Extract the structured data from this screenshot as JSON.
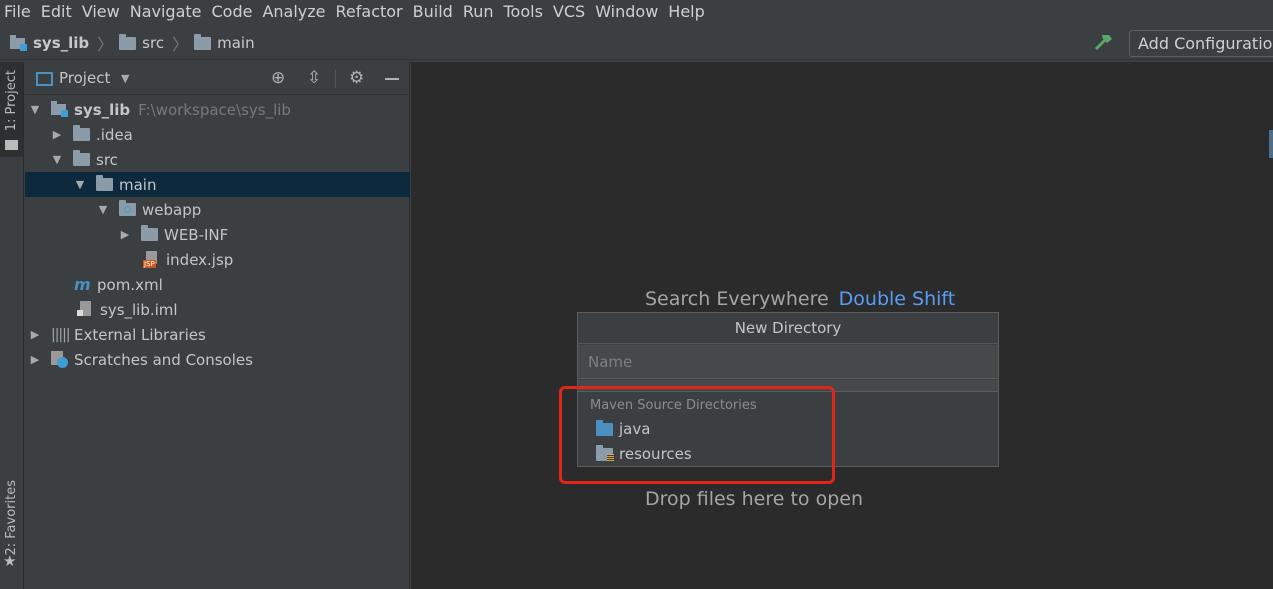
{
  "menu": [
    "File",
    "Edit",
    "View",
    "Navigate",
    "Code",
    "Analyze",
    "Refactor",
    "Build",
    "Run",
    "Tools",
    "VCS",
    "Window",
    "Help"
  ],
  "breadcrumb": {
    "project": "sys_lib",
    "src": "src",
    "main": "main"
  },
  "toolbar": {
    "add_configuration": "Add Configuration..."
  },
  "left_strip": {
    "project_tab": "1: Project",
    "favorites_tab": "2: Favorites"
  },
  "project_panel": {
    "title": "Project",
    "tree": [
      {
        "label": "sys_lib",
        "hint": "F:\\workspace\\sys_lib"
      },
      {
        "label": ".idea"
      },
      {
        "label": "src"
      },
      {
        "label": "main"
      },
      {
        "label": "webapp"
      },
      {
        "label": "WEB-INF"
      },
      {
        "label": "index.jsp"
      },
      {
        "label": "pom.xml"
      },
      {
        "label": "sys_lib.iml"
      },
      {
        "label": "External Libraries"
      },
      {
        "label": "Scratches and Consoles"
      }
    ]
  },
  "editor": {
    "search_hint": "Search Everywhere",
    "search_shortcut": "Double Shift",
    "drop_hint": "Drop files here to open"
  },
  "dialog": {
    "title": "New Directory",
    "name_placeholder": "Name",
    "section_label": "Maven Source Directories",
    "items": [
      "java",
      "resources"
    ]
  },
  "colors": {
    "accent": "#589df6",
    "highlight_box": "#e0251b",
    "selection": "#0d293e"
  }
}
